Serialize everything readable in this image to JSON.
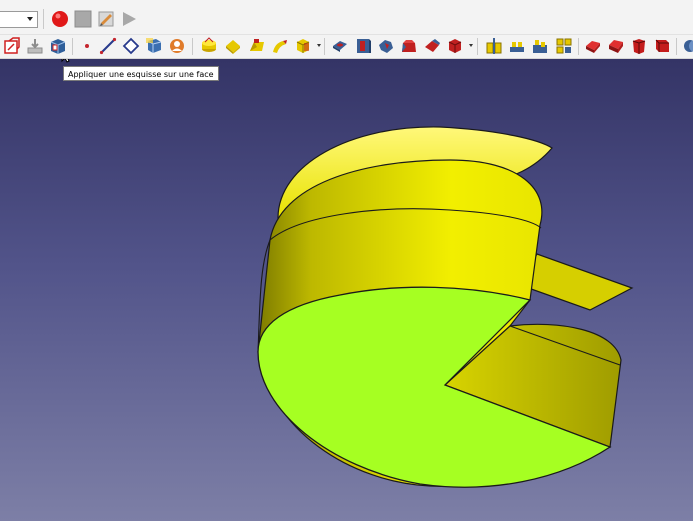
{
  "app": {
    "workbench_combo": {
      "value": ""
    }
  },
  "macro_toolbar": {
    "items": [
      {
        "icon": "record-macro-icon"
      },
      {
        "icon": "stop-macro-icon"
      },
      {
        "icon": "edit-macro-icon"
      },
      {
        "icon": "execute-macro-icon"
      }
    ]
  },
  "partdesign_toolbar": {
    "items": [
      {
        "icon": "create-sketch-icon"
      },
      {
        "icon": "validate-sketch-icon"
      },
      {
        "icon": "map-sketch-to-face-icon"
      },
      {
        "icon": "datum-point-icon"
      },
      {
        "icon": "datum-line-icon"
      },
      {
        "icon": "datum-plane-icon"
      },
      {
        "icon": "shape-binder-icon"
      },
      {
        "icon": "clone-icon"
      },
      {
        "icon": "pad-icon"
      },
      {
        "icon": "revolution-icon"
      },
      {
        "icon": "additive-loft-icon"
      },
      {
        "icon": "additive-pipe-icon"
      },
      {
        "icon": "additive-primitive-icon"
      },
      {
        "icon": "pocket-icon"
      },
      {
        "icon": "hole-icon"
      },
      {
        "icon": "groove-icon"
      },
      {
        "icon": "subtractive-loft-icon"
      },
      {
        "icon": "subtractive-pipe-icon"
      },
      {
        "icon": "subtractive-primitive-icon"
      },
      {
        "icon": "mirrored-icon"
      },
      {
        "icon": "linear-pattern-icon"
      },
      {
        "icon": "polar-pattern-icon"
      },
      {
        "icon": "multi-transform-icon"
      },
      {
        "icon": "fillet-icon"
      },
      {
        "icon": "chamfer-icon"
      },
      {
        "icon": "draft-icon"
      },
      {
        "icon": "thickness-icon"
      },
      {
        "icon": "boolean-icon"
      }
    ]
  },
  "tooltip": {
    "text": "Appliquer une esquisse sur une face"
  },
  "viewport": {
    "background_top": "#343466",
    "background_bottom": "#7d7fa6",
    "model_colors": {
      "selected_face": "#a6ff22",
      "body": "#e6e600",
      "body_shadow": "#8d8a00",
      "edge": "#1a1a1a"
    }
  }
}
